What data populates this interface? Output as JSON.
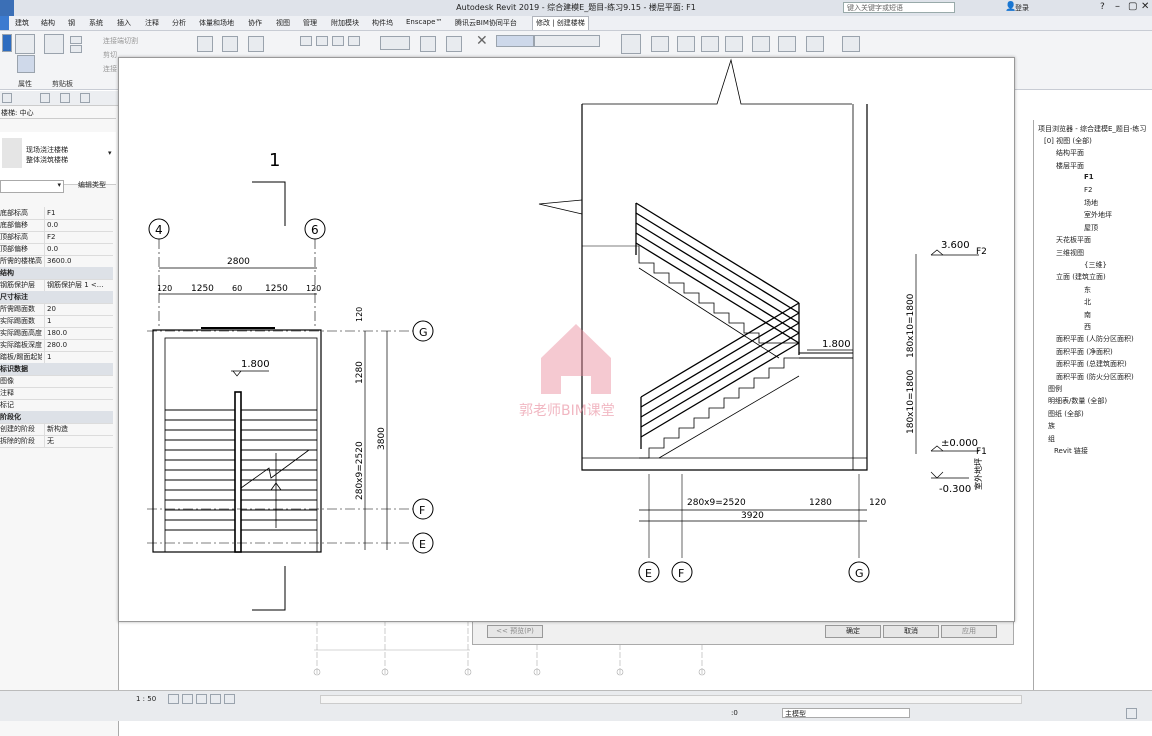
{
  "app": {
    "title": "Autodesk Revit 2019 - 综合建模E_题目-练习9.15 - 楼层平面: F1",
    "search_placeholder": "键入关键字或短语",
    "login": "登录"
  },
  "tabs": [
    "建筑",
    "结构",
    "钢",
    "系统",
    "插入",
    "注释",
    "分析",
    "体量和场地",
    "协作",
    "视图",
    "管理",
    "附加模块",
    "构件坞",
    "Enscape™",
    "腾讯云BIM协同平台",
    "修改 | 创建楼梯"
  ],
  "ribbon": {
    "labels": {
      "props": "属性",
      "clipboard": "剪贴板",
      "modify_label": "修改",
      "a1": "连接端切割",
      "a2": "剪切",
      "a3": "连接",
      "a4": "修改"
    }
  },
  "properties": {
    "family_line1": "现场浇注楼梯",
    "family_line2": "整体浇筑楼梯",
    "filter": "楼梯: 中心",
    "edit_type": "编辑类型",
    "rows": [
      {
        "k": "底部标高",
        "v": "F1"
      },
      {
        "k": "底部偏移",
        "v": "0.0"
      },
      {
        "k": "顶部标高",
        "v": "F2"
      },
      {
        "k": "顶部偏移",
        "v": "0.0"
      },
      {
        "k": "所需的楼梯高度",
        "v": "3600.0"
      },
      {
        "k": "结构",
        "v": "",
        "grp": true
      },
      {
        "k": "钢筋保护层",
        "v": "钢筋保护层 1 <..."
      },
      {
        "k": "尺寸标注",
        "v": "",
        "grp": true
      },
      {
        "k": "所需踢面数",
        "v": "20"
      },
      {
        "k": "实际踢面数",
        "v": "1"
      },
      {
        "k": "实际踢面高度",
        "v": "180.0"
      },
      {
        "k": "实际踏板深度",
        "v": "280.0"
      },
      {
        "k": "踏板/踢面起始编号",
        "v": "1"
      },
      {
        "k": "标识数据",
        "v": "",
        "grp": true
      },
      {
        "k": "图像",
        "v": ""
      },
      {
        "k": "注释",
        "v": ""
      },
      {
        "k": "标记",
        "v": ""
      },
      {
        "k": "阶段化",
        "v": "",
        "grp": true
      },
      {
        "k": "创建的阶段",
        "v": "新构造"
      },
      {
        "k": "拆除的阶段",
        "v": "无"
      }
    ],
    "apply": "应用"
  },
  "plan": {
    "section": "1",
    "grid4": "4",
    "grid6": "6",
    "gridG": "G",
    "gridF": "F",
    "gridE": "E",
    "dim_total": "2800",
    "d1": "120",
    "d2": "1250",
    "d3": "60",
    "d4": "1250",
    "d5": "120",
    "v_top": "120",
    "v1": "1280",
    "v2": "280x9=2520",
    "v_total": "3800",
    "landing": "1.800"
  },
  "section": {
    "lv_top": "3.600",
    "lv_top_tag": "F2",
    "lv_mid": "1.800",
    "lv_0": "±0.000",
    "lv_0_tag": "F1",
    "lv_out": "-0.300",
    "lv_out_tag": "室外地坪",
    "vd1": "180x10=1800",
    "vd2": "180x10=1800",
    "hd1": "280x9=2520",
    "hd2": "1280",
    "hd3": "120",
    "hd_total": "3920",
    "gE": "E",
    "gF": "F",
    "gG": "G"
  },
  "watermark": "郭老师BIM课堂",
  "dialog": {
    "prev": "<< 预览(P)",
    "ok": "确定",
    "cancel": "取消",
    "apply": "应用"
  },
  "browser": {
    "title": "项目浏览器 - 综合建模E_题目-练习",
    "items": [
      {
        "t": "[0] 视图 (全部)",
        "x": 4
      },
      {
        "t": "结构平面",
        "x": 16
      },
      {
        "t": "楼层平面",
        "x": 16
      },
      {
        "t": "F1",
        "x": 44,
        "bold": true
      },
      {
        "t": "F2",
        "x": 44
      },
      {
        "t": "场地",
        "x": 44
      },
      {
        "t": "室外地坪",
        "x": 44
      },
      {
        "t": "屋顶",
        "x": 44
      },
      {
        "t": "天花板平面",
        "x": 16
      },
      {
        "t": "三维视图",
        "x": 16
      },
      {
        "t": "{三维}",
        "x": 44
      },
      {
        "t": "立面 (建筑立面)",
        "x": 16
      },
      {
        "t": "东",
        "x": 44
      },
      {
        "t": "北",
        "x": 44
      },
      {
        "t": "南",
        "x": 44
      },
      {
        "t": "西",
        "x": 44
      },
      {
        "t": "面积平面 (人防分区面积)",
        "x": 16
      },
      {
        "t": "面积平面 (净面积)",
        "x": 16
      },
      {
        "t": "面积平面 (总建筑面积)",
        "x": 16
      },
      {
        "t": "面积平面 (防火分区面积)",
        "x": 16
      },
      {
        "t": "图例",
        "x": 8
      },
      {
        "t": "明细表/数量 (全部)",
        "x": 8
      },
      {
        "t": "图纸 (全部)",
        "x": 8
      },
      {
        "t": "族",
        "x": 8
      },
      {
        "t": "组",
        "x": 8
      },
      {
        "t": "Revit 链接",
        "x": 14
      }
    ]
  },
  "status": {
    "scale": "1 : 50",
    "zero": ":0",
    "model": "主模型"
  }
}
